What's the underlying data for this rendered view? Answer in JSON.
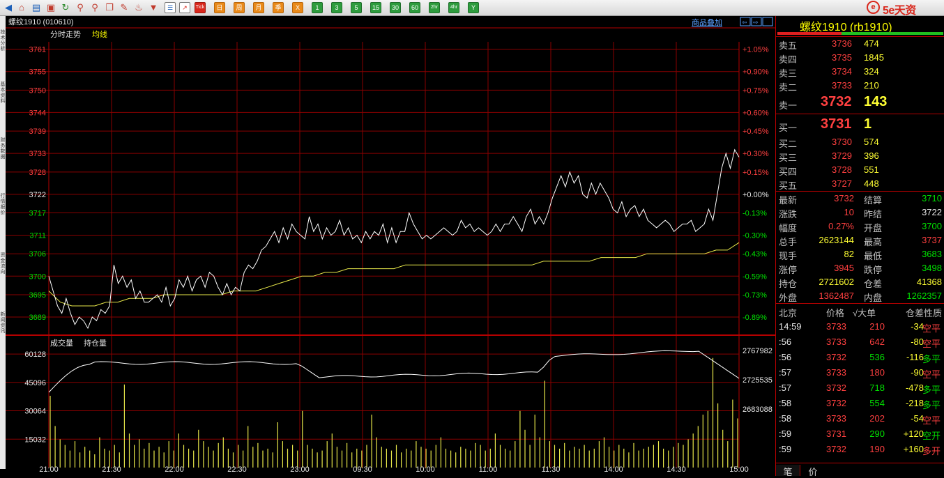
{
  "toolbar": {
    "buttons": [
      "Tick",
      "日",
      "周",
      "月",
      "季",
      "X",
      "1",
      "3",
      "5",
      "15",
      "30",
      "60",
      "2hr",
      "4hr",
      "Y"
    ]
  },
  "brand": {
    "logo": "e",
    "name": "5e天资",
    "url": ".com"
  },
  "left_sidebar": {
    "tabs": [
      "技术分析",
      "基本资料",
      "财务数据",
      "行情报价",
      "资金流向",
      "新闻资讯"
    ]
  },
  "chart_header": {
    "title": "螺纹1910 (010610)",
    "minute_label": "分时走势",
    "avg_label": "均线",
    "overlay_button": "商品叠加"
  },
  "price_axis": {
    "left_labels": [
      "3761",
      "3755",
      "3750",
      "3744",
      "3739",
      "3733",
      "3728",
      "3722",
      "3717",
      "3711",
      "3706",
      "3700",
      "3695",
      "3689"
    ],
    "right_labels": [
      "+1.05%",
      "+0.90%",
      "+0.75%",
      "+0.60%",
      "+0.45%",
      "+0.30%",
      "+0.15%",
      "+0.00%",
      "-0.13%",
      "-0.30%",
      "-0.43%",
      "-0.59%",
      "-0.73%",
      "-0.89%"
    ]
  },
  "volume_panel": {
    "volume_label": "成交量",
    "oi_label": "持仓量",
    "left_labels": [
      "60128",
      "45096",
      "30064",
      "15032"
    ],
    "right_labels": [
      "2767982",
      "2725535",
      "2683088"
    ]
  },
  "time_axis": [
    "21:00",
    "21:30",
    "22:00",
    "22:30",
    "23:00",
    "09:30",
    "10:00",
    "11:00",
    "11:30",
    "14:00",
    "14:30",
    "15:00"
  ],
  "chart_data": {
    "type": "line",
    "ylim": [
      3686,
      3763
    ],
    "prev_close": 3722,
    "price": [
      3700,
      3696,
      3692,
      3690,
      3694,
      3690,
      3687,
      3689,
      3688,
      3686,
      3689,
      3688,
      3691,
      3690,
      3692,
      3703,
      3698,
      3700,
      3697,
      3699,
      3694,
      3696,
      3693,
      3693,
      3694,
      3695,
      3693,
      3697,
      3692,
      3694,
      3699,
      3697,
      3700,
      3696,
      3699,
      3700,
      3697,
      3701,
      3700,
      3697,
      3695,
      3698,
      3695,
      3697,
      3696,
      3701,
      3703,
      3702,
      3704,
      3707,
      3708,
      3710,
      3712,
      3709,
      3713,
      3710,
      3714,
      3712,
      3711,
      3710,
      3716,
      3712,
      3714,
      3710,
      3713,
      3711,
      3712,
      3715,
      3711,
      3713,
      3710,
      3711,
      3709,
      3712,
      3710,
      3712,
      3711,
      3714,
      3709,
      3713,
      3709,
      3712,
      3712,
      3717,
      3714,
      3712,
      3710,
      3711,
      3710,
      3711,
      3712,
      3713,
      3712,
      3711,
      3712,
      3715,
      3713,
      3714,
      3712,
      3713,
      3712,
      3711,
      3712,
      3714,
      3712,
      3714,
      3714,
      3716,
      3714,
      3712,
      3716,
      3718,
      3714,
      3716,
      3714,
      3717,
      3721,
      3724,
      3727,
      3724,
      3728,
      3725,
      3727,
      3722,
      3721,
      3725,
      3722,
      3725,
      3723,
      3721,
      3718,
      3717,
      3720,
      3716,
      3718,
      3719,
      3716,
      3718,
      3715,
      3714,
      3713,
      3714,
      3715,
      3714,
      3712,
      3713,
      3714,
      3714,
      3715,
      3712,
      3713,
      3714,
      3718,
      3715,
      3722,
      3729,
      3733,
      3729,
      3734,
      3732
    ],
    "avg": [
      3696,
      3693,
      3692,
      3692,
      3692,
      3693,
      3693,
      3694,
      3694,
      3694,
      3695,
      3695,
      3695,
      3695,
      3695,
      3695,
      3696,
      3696,
      3696,
      3697,
      3698,
      3699,
      3700,
      3700,
      3701,
      3701,
      3702,
      3702,
      3702,
      3702,
      3702,
      3703,
      3703,
      3703,
      3703,
      3703,
      3703,
      3703,
      3703,
      3703,
      3703,
      3703,
      3703,
      3704,
      3704,
      3704,
      3704,
      3704,
      3705,
      3705,
      3705,
      3705,
      3706,
      3706,
      3706,
      3706,
      3706,
      3706,
      3707,
      3707,
      3709
    ],
    "volume": [
      38000,
      22000,
      15000,
      12000,
      9000,
      14000,
      8000,
      11000,
      9000,
      7000,
      16000,
      10000,
      9000,
      12000,
      8000,
      44000,
      18000,
      12000,
      15000,
      10000,
      13000,
      9000,
      11000,
      8000,
      14000,
      9000,
      18000,
      12000,
      10000,
      9000,
      20000,
      14000,
      11000,
      9000,
      13000,
      16000,
      10000,
      8000,
      12000,
      9000,
      22000,
      11000,
      13000,
      9000,
      10000,
      8000,
      24000,
      14000,
      10000,
      12000,
      9000,
      30000,
      12000,
      10000,
      8000,
      9000,
      14000,
      18000,
      11000,
      9000,
      13000,
      8000,
      10000,
      9000,
      12000,
      28000,
      16000,
      11000,
      10000,
      9000,
      12000,
      8000,
      10000,
      9000,
      14000,
      11000,
      10000,
      9000,
      12000,
      16000,
      10000,
      9000,
      8000,
      11000,
      10000,
      9000,
      13000,
      12000,
      9000,
      10000,
      18000,
      12000,
      10000,
      9000,
      14000,
      30000,
      20000,
      12000,
      28000,
      16000,
      46000,
      14000,
      12000,
      10000,
      13000,
      9000,
      11000,
      10000,
      12000,
      9000,
      10000,
      14000,
      16000,
      11000,
      9000,
      12000,
      10000,
      8000,
      13000,
      9000,
      10000,
      11000,
      12000,
      14000,
      10000,
      9000,
      11000,
      13000,
      12000,
      15000,
      18000,
      22000,
      28000,
      30000,
      58000,
      34000,
      20000,
      14000,
      36000,
      26000
    ]
  },
  "quote_panel": {
    "title": "螺纹1910 (rb1910)",
    "asks": [
      {
        "label": "卖五",
        "price": "3736",
        "vol": "474"
      },
      {
        "label": "卖四",
        "price": "3735",
        "vol": "1845"
      },
      {
        "label": "卖三",
        "price": "3734",
        "vol": "324"
      },
      {
        "label": "卖二",
        "price": "3733",
        "vol": "210"
      }
    ],
    "ask1": {
      "label": "卖一",
      "price": "3732",
      "vol": "143"
    },
    "bid1": {
      "label": "买一",
      "price": "3731",
      "vol": "1"
    },
    "bids": [
      {
        "label": "买二",
        "price": "3730",
        "vol": "574"
      },
      {
        "label": "买三",
        "price": "3729",
        "vol": "396"
      },
      {
        "label": "买四",
        "price": "3728",
        "vol": "551"
      },
      {
        "label": "买五",
        "price": "3727",
        "vol": "448"
      }
    ],
    "stats": [
      {
        "l1": "最新",
        "v1": "3732",
        "c1": "red",
        "l2": "结算",
        "v2": "3710",
        "c2": "grn"
      },
      {
        "l1": "涨跌",
        "v1": "10",
        "c1": "red",
        "l2": "昨结",
        "v2": "3722",
        "c2": "wht"
      },
      {
        "l1": "幅度",
        "v1": "0.27%",
        "c1": "red",
        "l2": "开盘",
        "v2": "3700",
        "c2": "grn"
      },
      {
        "l1": "总手",
        "v1": "2623144",
        "c1": "yel",
        "l2": "最高",
        "v2": "3737",
        "c2": "red"
      },
      {
        "l1": "现手",
        "v1": "82",
        "c1": "yel",
        "l2": "最低",
        "v2": "3683",
        "c2": "grn"
      },
      {
        "l1": "涨停",
        "v1": "3945",
        "c1": "red",
        "l2": "跌停",
        "v2": "3498",
        "c2": "grn"
      },
      {
        "l1": "持仓",
        "v1": "2721602",
        "c1": "yel",
        "l2": "仓差",
        "v2": "41368",
        "c2": "yel"
      },
      {
        "l1": "外盘",
        "v1": "1362487",
        "c1": "red",
        "l2": "内盘",
        "v2": "1262357",
        "c2": "grn"
      }
    ],
    "ticks_header": [
      "北京",
      "价格",
      "√大单",
      "仓差",
      "性质"
    ],
    "ticks": [
      {
        "time": "14:59",
        "price": "3733",
        "pc": "red",
        "vol": "210",
        "vc": "red",
        "oi": "-34",
        "nat": "空平",
        "nc": "red"
      },
      {
        "time": ":56",
        "price": "3733",
        "pc": "red",
        "vol": "642",
        "vc": "red",
        "oi": "-80",
        "nat": "空平",
        "nc": "red"
      },
      {
        "time": ":56",
        "price": "3732",
        "pc": "red",
        "vol": "536",
        "vc": "grn",
        "oi": "-116",
        "nat": "多平",
        "nc": "grn"
      },
      {
        "time": ":57",
        "price": "3733",
        "pc": "red",
        "vol": "180",
        "vc": "red",
        "oi": "-90",
        "nat": "空平",
        "nc": "red"
      },
      {
        "time": ":57",
        "price": "3732",
        "pc": "red",
        "vol": "718",
        "vc": "grn",
        "oi": "-478",
        "nat": "多平",
        "nc": "grn"
      },
      {
        "time": ":58",
        "price": "3732",
        "pc": "red",
        "vol": "554",
        "vc": "grn",
        "oi": "-218",
        "nat": "多平",
        "nc": "grn"
      },
      {
        "time": ":58",
        "price": "3733",
        "pc": "red",
        "vol": "202",
        "vc": "red",
        "oi": "-54",
        "nat": "空平",
        "nc": "red"
      },
      {
        "time": ":59",
        "price": "3731",
        "pc": "red",
        "vol": "290",
        "vc": "grn",
        "oi": "+120",
        "nat": "空开",
        "nc": "grn"
      },
      {
        "time": ":59",
        "price": "3732",
        "pc": "red",
        "vol": "190",
        "vc": "red",
        "oi": "+160",
        "nat": "多开",
        "nc": "red"
      }
    ],
    "tabs": [
      "笔",
      "价"
    ]
  }
}
